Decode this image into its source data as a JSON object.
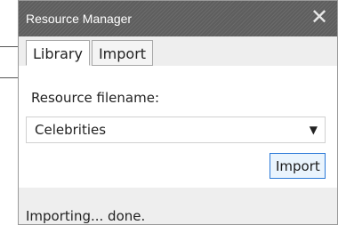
{
  "window": {
    "title": "Resource Manager",
    "close_glyph": "✕"
  },
  "tabs": [
    {
      "label": "Library",
      "active": true
    },
    {
      "label": "Import",
      "active": false
    }
  ],
  "form": {
    "filename_label": "Resource filename:",
    "filename_value": "Celebrities",
    "dropdown_glyph": "▼",
    "import_label": "Import"
  },
  "status": {
    "text": "Importing... done."
  },
  "colors": {
    "titlebar": "#5e5e5e",
    "accent": "#2b79d8",
    "window_bg": "#eeeeee"
  }
}
